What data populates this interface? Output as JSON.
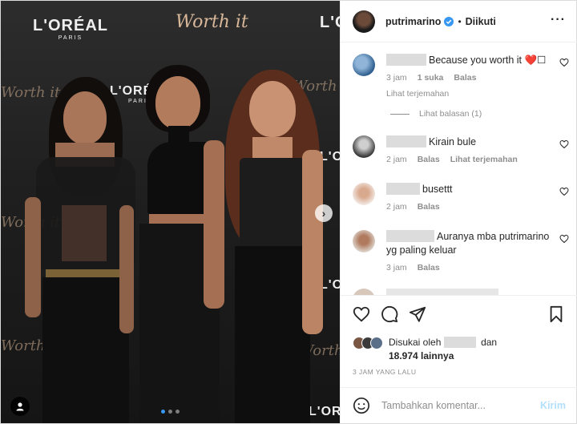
{
  "post": {
    "owner": {
      "username": "putrimarino",
      "follow_status": "Diikuti"
    },
    "separator": "•"
  },
  "photo": {
    "backdrop": {
      "brand": "L'ORÉAL",
      "brand_sub": "PARIS",
      "script": "Worth it"
    },
    "carousel_dots": 3,
    "active_dot": 0
  },
  "comments": [
    {
      "text": "Because you worth it ❤️☐",
      "time": "3 jam",
      "likes": "1 suka",
      "reply": "Balas",
      "translate": "Lihat terjemahan",
      "view_replies": "Lihat balasan (1)"
    },
    {
      "text": "Kirain bule",
      "time": "2 jam",
      "reply": "Balas",
      "translate": "Lihat terjemahan"
    },
    {
      "text": "busettt",
      "time": "2 jam",
      "reply": "Balas"
    },
    {
      "text": "Auranya mba putrimarino yg paling keluar",
      "time": "3 jam",
      "reply": "Balas"
    }
  ],
  "likes": {
    "prefix": "Disukai oleh",
    "conjunction": "dan",
    "count": "18.974 lainnya"
  },
  "timestamp": "3 JAM YANG LALU",
  "comment_box": {
    "placeholder": "Tambahkan komentar...",
    "post_label": "Kirim"
  },
  "colors": {
    "verified": "#3897f0",
    "post_disabled": "#b2dffc",
    "muted": "#8e8e8e",
    "carousel_active": "#3897f0"
  }
}
